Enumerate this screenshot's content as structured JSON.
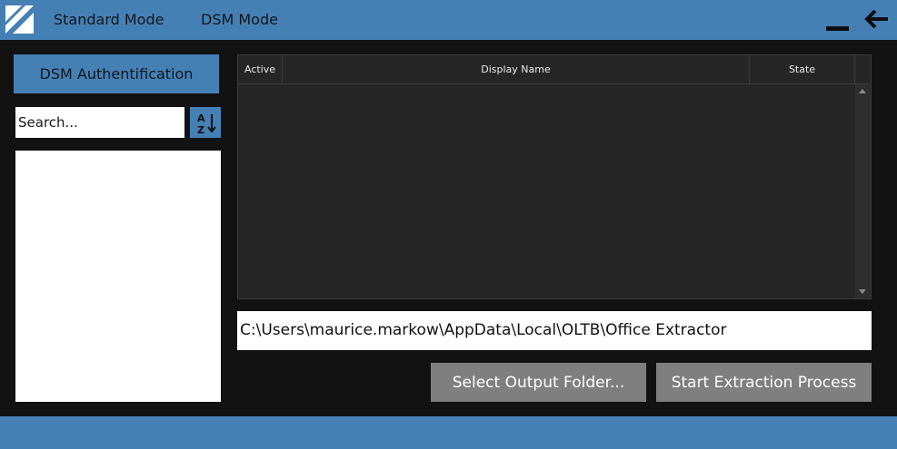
{
  "header": {
    "tabs": [
      {
        "label": "Standard Mode"
      },
      {
        "label": "DSM Mode"
      }
    ],
    "icons": {
      "logo": "app-logo-icon",
      "minimize": "minimize-icon",
      "back": "arrow-left-icon"
    },
    "accent": "#4580b5"
  },
  "sidebar": {
    "auth_button": "DSM Authentification",
    "search": {
      "value": "Search..."
    },
    "sort_icon": "sort-az-icon"
  },
  "table": {
    "columns": [
      "Active",
      "Display Name",
      "State"
    ],
    "rows": []
  },
  "output": {
    "path": "C:\\Users\\maurice.markow\\AppData\\Local\\OLTB\\Office Extractor",
    "select_button": "Select Output Folder...",
    "start_button": "Start Extraction Process"
  }
}
